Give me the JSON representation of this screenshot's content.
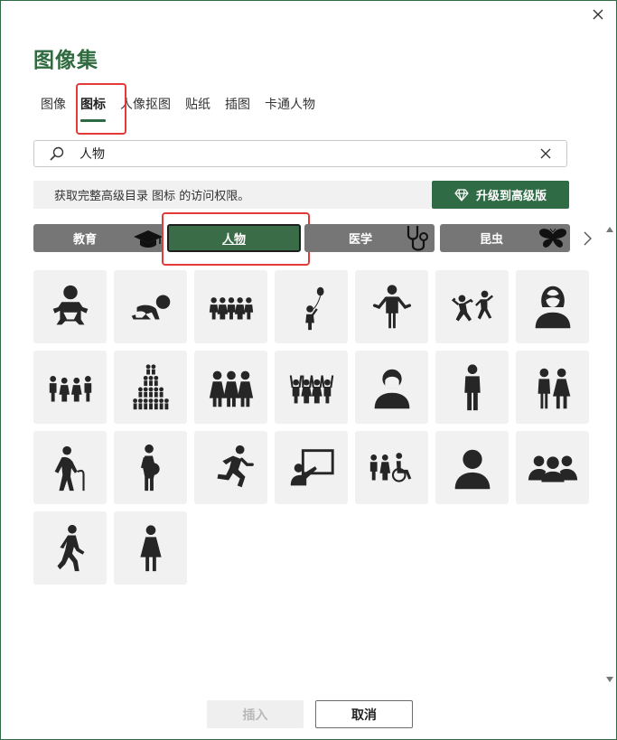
{
  "dialog": {
    "title": "图像集",
    "close_label": "close"
  },
  "tabs": [
    {
      "label": "图像",
      "active": false
    },
    {
      "label": "图标",
      "active": true
    },
    {
      "label": "人像抠图",
      "active": false
    },
    {
      "label": "贴纸",
      "active": false
    },
    {
      "label": "插图",
      "active": false
    },
    {
      "label": "卡通人物",
      "active": false
    }
  ],
  "search": {
    "value": "人物",
    "placeholder": ""
  },
  "banner": {
    "text": "获取完整高级目录 图标 的访问权限。",
    "upgrade_label": "升级到高级版"
  },
  "categories": [
    {
      "label": "教育",
      "icon": "graduation-cap-icon",
      "active": false
    },
    {
      "label": "人物",
      "icon": "",
      "active": true
    },
    {
      "label": "医学",
      "icon": "stethoscope-icon",
      "active": false
    },
    {
      "label": "昆虫",
      "icon": "butterfly-icon",
      "active": false
    }
  ],
  "icons": [
    "baby-icon",
    "crawling-baby-icon",
    "group-of-children-icon",
    "child-with-balloon-icon",
    "man-shrugging-icon",
    "children-playing-icon",
    "woman-bust-icon",
    "family-icon",
    "crowd-pyramid-icon",
    "three-women-icon",
    "cheering-crowd-icon",
    "man-bust-icon",
    "man-standing-icon",
    "couple-icon",
    "elderly-with-cane-icon",
    "pregnant-woman-icon",
    "running-man-icon",
    "teacher-presenting-icon",
    "accessibility-group-icon",
    "user-bust-icon",
    "user-group-icon",
    "walking-man-icon",
    "woman-standing-icon"
  ],
  "footer": {
    "insert_label": "插入",
    "cancel_label": "取消"
  },
  "colors": {
    "accent": "#2f6b45",
    "title": "#2f6b3e",
    "category": "#767676",
    "highlight": "#e43a3a"
  }
}
